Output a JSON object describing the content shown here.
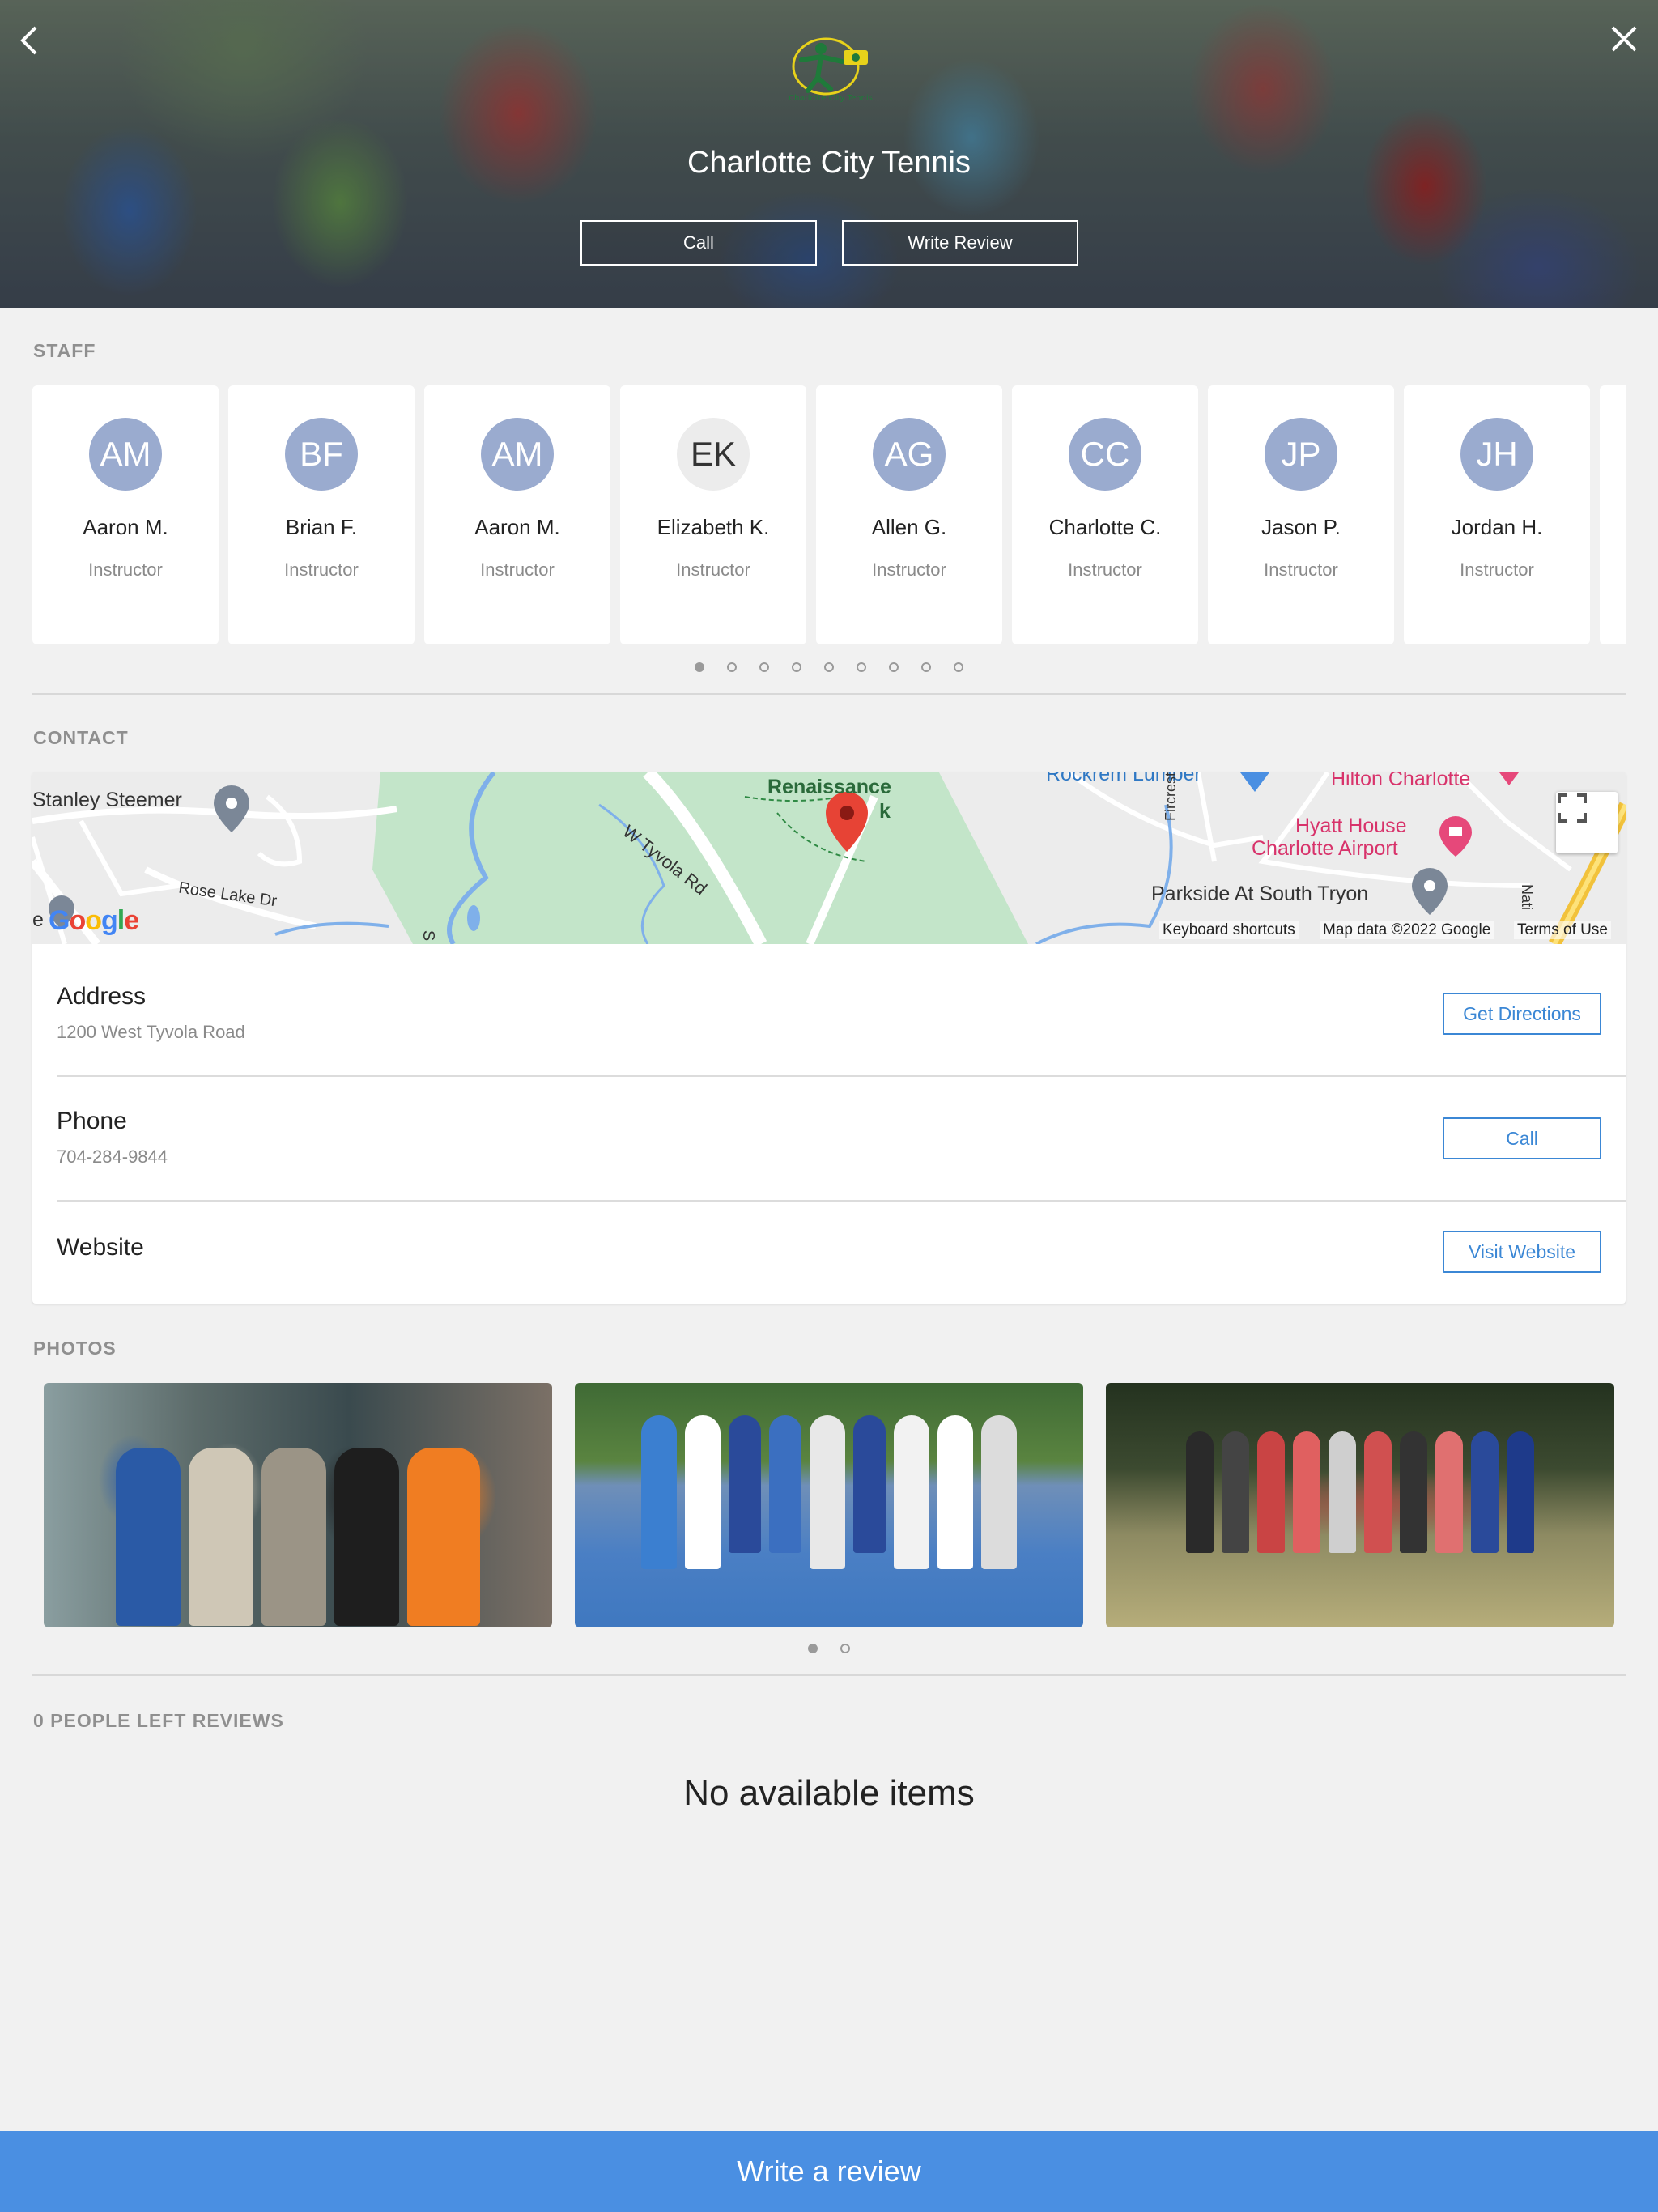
{
  "header": {
    "title": "Charlotte City Tennis",
    "logo_text": "Charlotte City Tennis",
    "call_label": "Call",
    "write_review_label": "Write Review"
  },
  "staff": {
    "section_title": "STAFF",
    "members": [
      {
        "initials": "AM",
        "name": "Aaron M.",
        "role": "Instructor"
      },
      {
        "initials": "BF",
        "name": "Brian F.",
        "role": "Instructor"
      },
      {
        "initials": "AM",
        "name": "Aaron M.",
        "role": "Instructor"
      },
      {
        "initials": "EK",
        "name": "Elizabeth K.",
        "role": "Instructor"
      },
      {
        "initials": "AG",
        "name": "Allen G.",
        "role": "Instructor"
      },
      {
        "initials": "CC",
        "name": "Charlotte C.",
        "role": "Instructor"
      },
      {
        "initials": "JP",
        "name": "Jason P.",
        "role": "Instructor"
      },
      {
        "initials": "JH",
        "name": "Jordan H.",
        "role": "Instructor"
      }
    ],
    "page_count": 9,
    "active_page": 1
  },
  "contact": {
    "section_title": "CONTACT",
    "map": {
      "labels": {
        "stanley": "Stanley Steemer",
        "renaissance_1": "Renaissance",
        "renaissance_2": "k",
        "rockrem": "Rockrem Lumber",
        "hilton": "Hilton Charlotte",
        "hyatt_1": "Hyatt House",
        "hyatt_2": "Charlotte Airport",
        "parkside": "Parkside At South Tryon",
        "tyvola": "W Tyvola Rd",
        "rose_lake": "Rose Lake Dr",
        "fircrest": "Fircrest Dr",
        "nati": "Nati",
        "edge_e": "e",
        "edge_s": "S"
      },
      "google": "Google",
      "keyboard_shortcuts": "Keyboard shortcuts",
      "map_data": "Map data ©2022 Google",
      "terms": "Terms of Use"
    },
    "address_label": "Address",
    "address_value": "1200 West Tyvola Road",
    "directions_label": "Get Directions",
    "phone_label": "Phone",
    "phone_value": "704-284-9844",
    "call_label": "Call",
    "website_label": "Website",
    "visit_label": "Visit Website"
  },
  "photos": {
    "section_title": "PHOTOS",
    "page_count": 2,
    "active_page": 1
  },
  "reviews": {
    "section_title": "0 PEOPLE LEFT REVIEWS",
    "empty_text": "No available items"
  },
  "bottom_bar": {
    "label": "Write a review"
  },
  "colors": {
    "accent": "#4a8fe2",
    "link_blue": "#3b87d5",
    "avatar": "#9aabcf"
  }
}
